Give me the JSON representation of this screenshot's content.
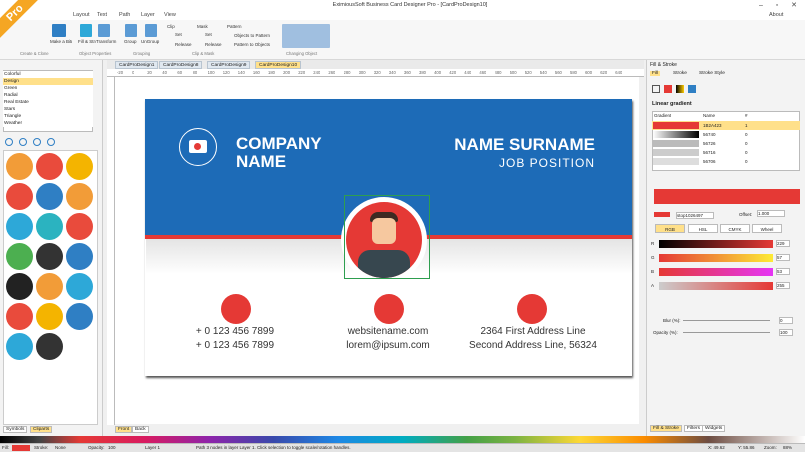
{
  "app": {
    "title": "EximiousSoft Business Card Designer Pro - [CardProDesign10]",
    "pro_badge": "Pro",
    "about": "About"
  },
  "menu": [
    "Layout",
    "Text",
    "Path",
    "Layer",
    "View"
  ],
  "ribbon": {
    "buttons": [
      "Make a Object",
      "Make a Bitmap Copy",
      "Fill & Stroke",
      "Transform",
      "Group",
      "UnGroup"
    ],
    "clip": {
      "title": "Clip",
      "set": "Set",
      "release": "Release"
    },
    "mask": {
      "title": "Mask",
      "set": "Set",
      "release": "Release"
    },
    "pattern": {
      "title": "Pattern",
      "to": "Objects to Pattern",
      "from": "Pattern to Objects"
    },
    "groups": [
      "Create & Clone",
      "Object Properties",
      "Grouping",
      "Clip & Mask",
      "Changing Object"
    ]
  },
  "left": {
    "list": [
      "Colorful",
      "Design",
      "Green",
      "Radial",
      "Real Estate",
      "Stars",
      "Triangle",
      "Weather"
    ],
    "selected": "Design",
    "tabs": [
      "Symbols",
      "Cliparts"
    ]
  },
  "doctabs": [
    "CardProDesign1",
    "CardProDesign8",
    "CardProDesign9",
    "CardProDesign10"
  ],
  "ruler": [
    "-20",
    "0",
    "20",
    "40",
    "60",
    "80",
    "100",
    "120",
    "140",
    "160",
    "180",
    "200",
    "220",
    "240",
    "260",
    "280",
    "300",
    "320",
    "340",
    "360",
    "380",
    "400",
    "420",
    "440",
    "460",
    "480",
    "500",
    "520",
    "540",
    "560",
    "580",
    "600",
    "620",
    "640"
  ],
  "card": {
    "company1": "COMPANY",
    "company2": "NAME",
    "name": "NAME SURNAME",
    "job": "JOB POSITION",
    "phone1": "+ 0 123 456 7899",
    "phone2": "+ 0 123 456 7899",
    "web": "websitename.com",
    "email": "lorem@ipsum.com",
    "addr1": "2364 First Address Line",
    "addr2": "Second Address Line, 56324"
  },
  "pagetabs": [
    "Front",
    "Back"
  ],
  "right": {
    "title": "Fill & Stroke",
    "tabs": [
      "Fill",
      "Stroke",
      "Stroke Style"
    ],
    "linear": "Linear gradient",
    "cols": [
      "Gradient",
      "Name",
      "#"
    ],
    "rows": [
      [
        "1B2A423",
        "1"
      ],
      [
        "56740",
        "0"
      ],
      [
        "56726",
        "0"
      ],
      [
        "56716",
        "0"
      ],
      [
        "56706",
        "0"
      ]
    ],
    "stop": "stop1026497",
    "offset_label": "Offset:",
    "offset": "1.000",
    "modes": [
      "RGB",
      "HSL",
      "CMYK",
      "Wheel"
    ],
    "channels": [
      {
        "l": "R",
        "v": "229"
      },
      {
        "l": "G",
        "v": "57"
      },
      {
        "l": "B",
        "v": "53"
      },
      {
        "l": "A",
        "v": "255"
      }
    ],
    "blur_label": "Blur (%):",
    "blur": "0",
    "opacity_label": "Opacity (%):",
    "opacity": "100",
    "bottomtabs": [
      "Fill & Stroke",
      "Filters",
      "Widgets"
    ],
    "colors": {
      "red": "#e53935",
      "accent": "#1d6bb7"
    }
  },
  "status": {
    "fill": "Fill:",
    "stroke": "Stroke:",
    "none": "None",
    "opacity": "Opacity:",
    "opacity_val": "100",
    "layer": "Layer 1",
    "msg": "Path 3 nodes in layer Layer 1. Click selection to toggle scale/rotation handles.",
    "x": "X: 49.62",
    "y": "Y: 55.86",
    "zoom": "Zoom:",
    "zoom_val": "88%"
  }
}
